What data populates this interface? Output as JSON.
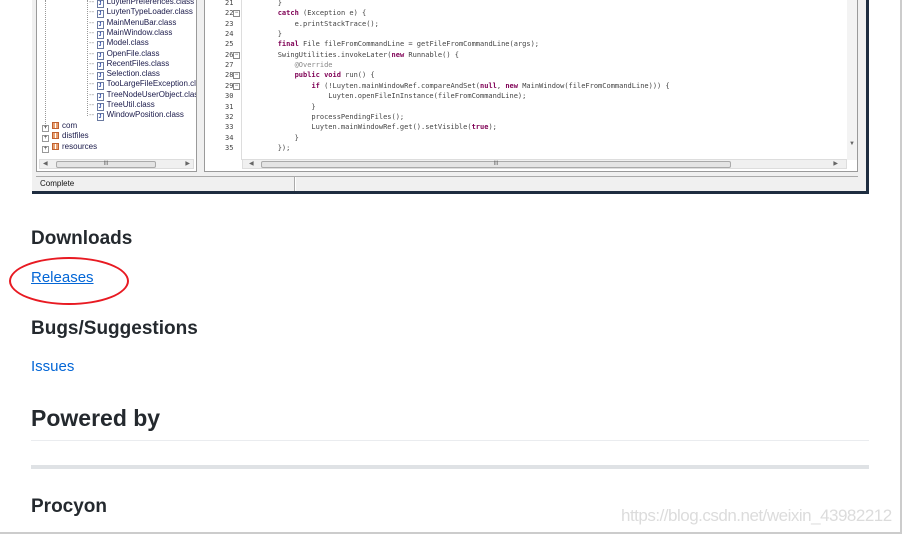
{
  "embedded_app": {
    "tree": {
      "classes": [
        "LuytenPreferences.class",
        "LuytenTypeLoader.class",
        "MainMenuBar.class",
        "MainWindow.class",
        "Model.class",
        "OpenFile.class",
        "RecentFiles.class",
        "Selection.class",
        "TooLargeFileException.class",
        "TreeNodeUserObject.class",
        "TreeUtil.class",
        "WindowPosition.class"
      ],
      "packages": [
        "com",
        "distfiles",
        "resources"
      ]
    },
    "code": [
      {
        "n": "21",
        "t": [
          [
            "        }",
            ""
          ]
        ]
      },
      {
        "n": "22",
        "f": true,
        "t": [
          [
            "        ",
            ""
          ],
          [
            "catch",
            "k"
          ],
          [
            " (Exception e) {",
            ""
          ]
        ]
      },
      {
        "n": "23",
        "t": [
          [
            "            e.printStackTrace();",
            ""
          ]
        ]
      },
      {
        "n": "24",
        "t": [
          [
            "        }",
            ""
          ]
        ]
      },
      {
        "n": "25",
        "t": [
          [
            "        ",
            ""
          ],
          [
            "final",
            "k"
          ],
          [
            " File fileFromCommandLine = getFileFromCommandLine(args);",
            ""
          ]
        ]
      },
      {
        "n": "26",
        "f": true,
        "t": [
          [
            "        SwingUtilities.invokeLater(",
            ""
          ],
          [
            "new",
            "k"
          ],
          [
            " Runnable() {",
            ""
          ]
        ]
      },
      {
        "n": "27",
        "t": [
          [
            "            ",
            ""
          ],
          [
            "@Override",
            "a"
          ]
        ]
      },
      {
        "n": "28",
        "f": true,
        "t": [
          [
            "            ",
            ""
          ],
          [
            "public void",
            "k"
          ],
          [
            " run() {",
            ""
          ]
        ]
      },
      {
        "n": "29",
        "f": true,
        "t": [
          [
            "                ",
            ""
          ],
          [
            "if",
            "k"
          ],
          [
            " (!Luyten.mainWindowRef.compareAndSet(",
            ""
          ],
          [
            "null",
            "k"
          ],
          [
            ", ",
            ""
          ],
          [
            "new",
            "k"
          ],
          [
            " MainWindow(fileFromCommandLine))) {",
            ""
          ]
        ]
      },
      {
        "n": "30",
        "t": [
          [
            "                    Luyten.openFileInInstance(fileFromCommandLine);",
            ""
          ]
        ]
      },
      {
        "n": "31",
        "t": [
          [
            "                }",
            ""
          ]
        ]
      },
      {
        "n": "32",
        "t": [
          [
            "                processPendingFiles();",
            ""
          ]
        ]
      },
      {
        "n": "33",
        "t": [
          [
            "                Luyten.mainWindowRef.get().setVisible(",
            ""
          ],
          [
            "true",
            "k"
          ],
          [
            ");",
            ""
          ]
        ]
      },
      {
        "n": "34",
        "t": [
          [
            "            }",
            ""
          ]
        ]
      },
      {
        "n": "35",
        "t": [
          [
            "        });",
            ""
          ]
        ]
      }
    ],
    "status": "Complete"
  },
  "sections": {
    "downloads": {
      "title": "Downloads",
      "link": "Releases"
    },
    "bugs": {
      "title": "Bugs/Suggestions",
      "link": "Issues"
    },
    "powered": {
      "title": "Powered by"
    },
    "procyon": {
      "title": "Procyon"
    }
  },
  "watermark": "https://blog.csdn.net/weixin_43982212",
  "colors": {
    "link": "#0366d6",
    "annotation_circle": "#e81a22",
    "window_border": "#1e2d40"
  }
}
